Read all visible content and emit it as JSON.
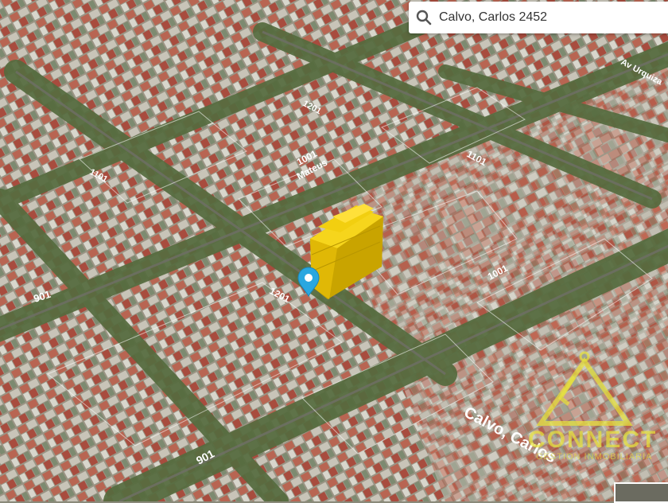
{
  "search": {
    "placeholder": "Calvo, Carlos 2452",
    "value": "Calvo, Carlos 2452"
  },
  "map": {
    "street_labels": {
      "calvo_carlos": "Calvo, Carlos",
      "mateus": "Mateus",
      "num_1001": "1001",
      "num_1101": "1101",
      "num_1201": "1201",
      "num_901": "901",
      "num_1001b": "1001",
      "num_1201b": "1201",
      "num_1101b": "1101",
      "num_901b": "901",
      "av_urquiza": "Av Urquiza"
    },
    "marker_icon": "location-pin-icon",
    "building_color": "#f0c800",
    "marker_color": "#2aa7e0"
  },
  "watermark": {
    "brand": "CONNECT",
    "subtitle": "GESTION INMOBILIARIA",
    "color": "#e8e23c"
  },
  "icons": {
    "search": "search-icon"
  }
}
